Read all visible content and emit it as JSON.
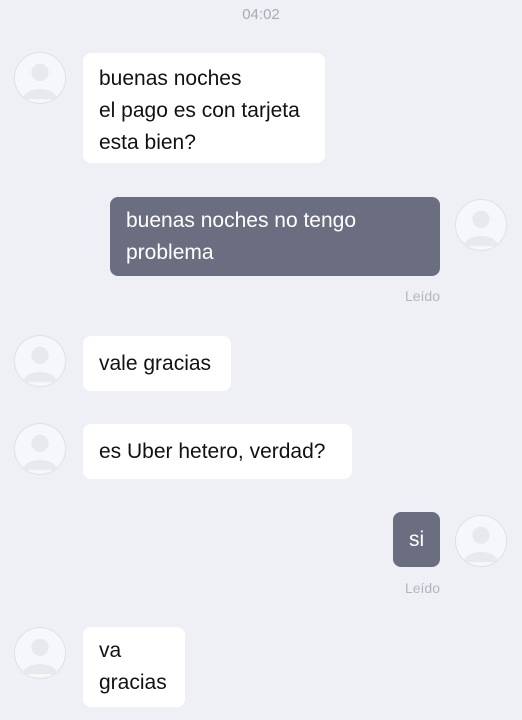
{
  "header": {
    "time": "04:02"
  },
  "messages": [
    {
      "direction": "in",
      "lines": [
        "buenas noches",
        "el pago es con tarjeta",
        "esta bien?"
      ]
    },
    {
      "direction": "out",
      "lines": [
        "buenas noches no tengo",
        "problema"
      ],
      "receipt": "Leído"
    },
    {
      "direction": "in",
      "lines": [
        "vale gracias"
      ]
    },
    {
      "direction": "in",
      "lines": [
        "es Uber hetero, verdad?"
      ]
    },
    {
      "direction": "out",
      "lines": [
        "si"
      ],
      "receipt": "Leído"
    },
    {
      "direction": "in",
      "lines": [
        "va",
        "gracias"
      ]
    }
  ],
  "colors": {
    "background": "#eef0f5",
    "incoming_bubble": "#ffffff",
    "outgoing_bubble": "#6b6e80",
    "meta_text": "#a8abb3"
  },
  "icons": {
    "avatar": "user-silhouette-icon"
  }
}
